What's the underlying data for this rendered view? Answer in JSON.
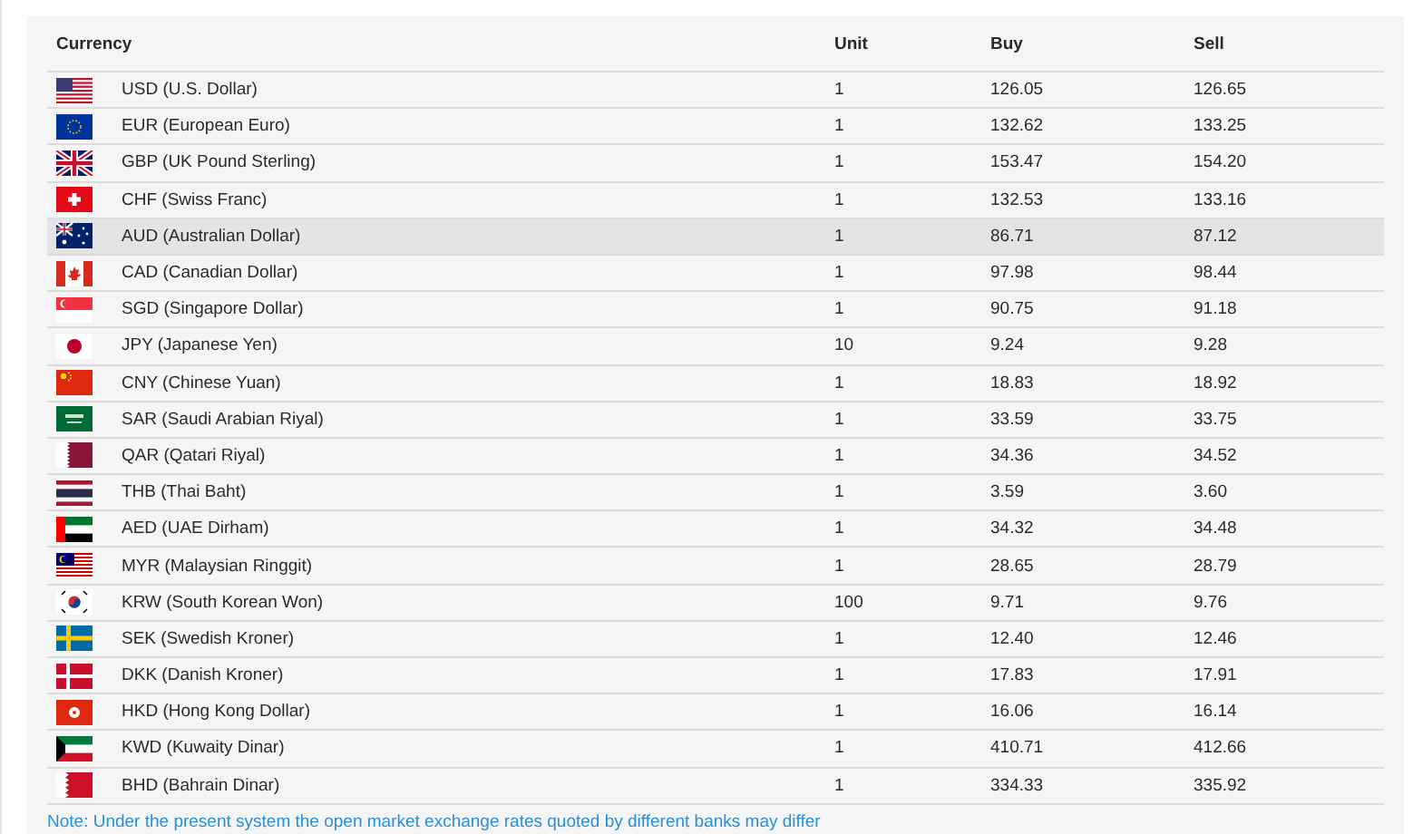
{
  "table": {
    "columns": [
      "Currency",
      "Unit",
      "Buy",
      "Sell"
    ],
    "rows": [
      {
        "currency": "USD (U.S. Dollar)",
        "unit": "1",
        "buy": "126.05",
        "sell": "126.65",
        "highlighted": false
      },
      {
        "currency": "EUR (European Euro)",
        "unit": "1",
        "buy": "132.62",
        "sell": "133.25",
        "highlighted": false
      },
      {
        "currency": "GBP (UK Pound Sterling)",
        "unit": "1",
        "buy": "153.47",
        "sell": "154.20",
        "highlighted": false
      },
      {
        "currency": "CHF (Swiss Franc)",
        "unit": "1",
        "buy": "132.53",
        "sell": "133.16",
        "highlighted": false
      },
      {
        "currency": "AUD (Australian Dollar)",
        "unit": "1",
        "buy": "86.71",
        "sell": "87.12",
        "highlighted": true
      },
      {
        "currency": "CAD (Canadian Dollar)",
        "unit": "1",
        "buy": "97.98",
        "sell": "98.44",
        "highlighted": false
      },
      {
        "currency": "SGD (Singapore Dollar)",
        "unit": "1",
        "buy": "90.75",
        "sell": "91.18",
        "highlighted": false
      },
      {
        "currency": "JPY (Japanese Yen)",
        "unit": "10",
        "buy": "9.24",
        "sell": "9.28",
        "highlighted": false
      },
      {
        "currency": "CNY (Chinese Yuan)",
        "unit": "1",
        "buy": "18.83",
        "sell": "18.92",
        "highlighted": false
      },
      {
        "currency": "SAR (Saudi Arabian Riyal)",
        "unit": "1",
        "buy": "33.59",
        "sell": "33.75",
        "highlighted": false
      },
      {
        "currency": "QAR (Qatari Riyal)",
        "unit": "1",
        "buy": "34.36",
        "sell": "34.52",
        "highlighted": false
      },
      {
        "currency": "THB (Thai Baht)",
        "unit": "1",
        "buy": "3.59",
        "sell": "3.60",
        "highlighted": false
      },
      {
        "currency": "AED (UAE Dirham)",
        "unit": "1",
        "buy": "34.32",
        "sell": "34.48",
        "highlighted": false
      },
      {
        "currency": "MYR (Malaysian Ringgit)",
        "unit": "1",
        "buy": "28.65",
        "sell": "28.79",
        "highlighted": false
      },
      {
        "currency": "KRW (South Korean Won)",
        "unit": "100",
        "buy": "9.71",
        "sell": "9.76",
        "highlighted": false
      },
      {
        "currency": "SEK (Swedish Kroner)",
        "unit": "1",
        "buy": "12.40",
        "sell": "12.46",
        "highlighted": false
      },
      {
        "currency": "DKK (Danish Kroner)",
        "unit": "1",
        "buy": "17.83",
        "sell": "17.91",
        "highlighted": false
      },
      {
        "currency": "HKD (Hong Kong Dollar)",
        "unit": "1",
        "buy": "16.06",
        "sell": "16.14",
        "highlighted": false
      },
      {
        "currency": "KWD (Kuwaity Dinar)",
        "unit": "1",
        "buy": "410.71",
        "sell": "412.66",
        "highlighted": false
      },
      {
        "currency": "BHD (Bahrain Dinar)",
        "unit": "1",
        "buy": "334.33",
        "sell": "335.92",
        "highlighted": false
      }
    ]
  },
  "note": "Note: Under the present system the open market exchange rates quoted by different banks may differ"
}
